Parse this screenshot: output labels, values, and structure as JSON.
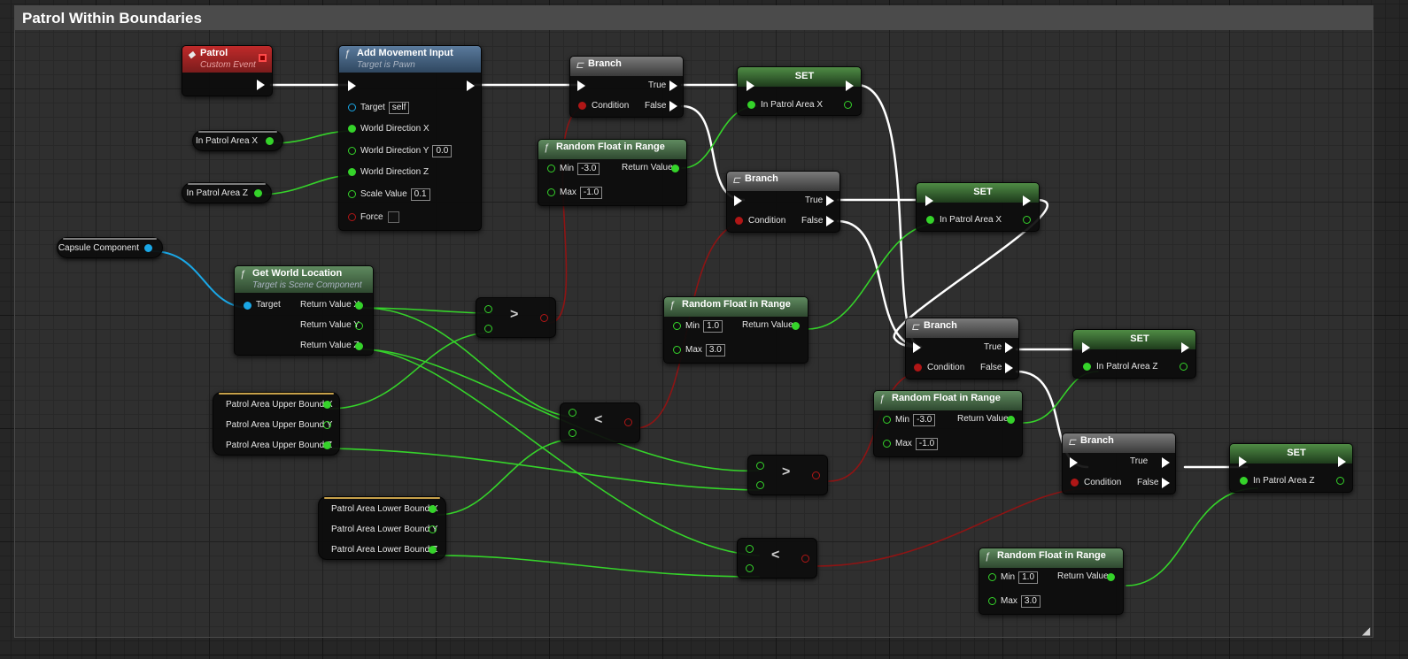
{
  "graph": {
    "title": "Patrol Within Boundaries"
  },
  "event_patrol": {
    "title": "Patrol",
    "subtitle": "Custom Event"
  },
  "add_movement": {
    "title": "Add Movement Input",
    "subtitle": "Target is Pawn",
    "target_label": "Target",
    "target_value": "self",
    "wdx_label": "World Direction X",
    "wdy_label": "World Direction Y",
    "wdy_value": "0.0",
    "wdz_label": "World Direction Z",
    "scale_label": "Scale Value",
    "scale_value": "0.1",
    "force_label": "Force"
  },
  "branch1": {
    "title": "Branch",
    "true": "True",
    "false": "False",
    "condition": "Condition"
  },
  "branch2": {
    "title": "Branch",
    "true": "True",
    "false": "False",
    "condition": "Condition"
  },
  "branch3": {
    "title": "Branch",
    "true": "True",
    "false": "False",
    "condition": "Condition"
  },
  "branch4": {
    "title": "Branch",
    "true": "True",
    "false": "False",
    "condition": "Condition"
  },
  "set1": {
    "title": "SET",
    "pin": "In Patrol Area X"
  },
  "set2": {
    "title": "SET",
    "pin": "In Patrol Area X"
  },
  "set3": {
    "title": "SET",
    "pin": "In Patrol Area Z"
  },
  "set4": {
    "title": "SET",
    "pin": "In Patrol Area Z"
  },
  "rand1": {
    "title": "Random Float in Range",
    "min_label": "Min",
    "min": "-3.0",
    "max_label": "Max",
    "max": "-1.0",
    "ret": "Return Value"
  },
  "rand2": {
    "title": "Random Float in Range",
    "min_label": "Min",
    "min": "1.0",
    "max_label": "Max",
    "max": "3.0",
    "ret": "Return Value"
  },
  "rand3": {
    "title": "Random Float in Range",
    "min_label": "Min",
    "min": "-3.0",
    "max_label": "Max",
    "max": "-1.0",
    "ret": "Return Value"
  },
  "rand4": {
    "title": "Random Float in Range",
    "min_label": "Min",
    "min": "1.0",
    "max_label": "Max",
    "max": "3.0",
    "ret": "Return Value"
  },
  "getworld": {
    "title": "Get World Location",
    "subtitle": "Target is Scene Component",
    "target": "Target",
    "rx": "Return Value X",
    "ry": "Return Value Y",
    "rz": "Return Value Z"
  },
  "vars": {
    "in_patrol_x": "In Patrol Area X",
    "in_patrol_z": "In Patrol Area Z",
    "capsule": "Capsule Component"
  },
  "upper": {
    "x": "Patrol Area Upper Bound X",
    "y": "Patrol Area Upper Bound Y",
    "z": "Patrol Area Upper Bound Z"
  },
  "lower": {
    "x": "Patrol Area Lower Bound X",
    "y": "Patrol Area Lower Bound Y",
    "z": "Patrol Area Lower Bound Z"
  },
  "ops": {
    "gt": ">",
    "lt": "<"
  },
  "icons": {
    "event": "diamond-event-icon",
    "function": "function-icon",
    "branch": "branch-icon",
    "resize": "resize-grip-icon"
  },
  "colors": {
    "exec": "#ffffff",
    "float": "#35d32a",
    "bool": "#b01616",
    "object": "#1aa7e6",
    "event_header": "#c02a2a",
    "function_header": "#5a7a9c",
    "pure_header": "#5f8a5f"
  }
}
